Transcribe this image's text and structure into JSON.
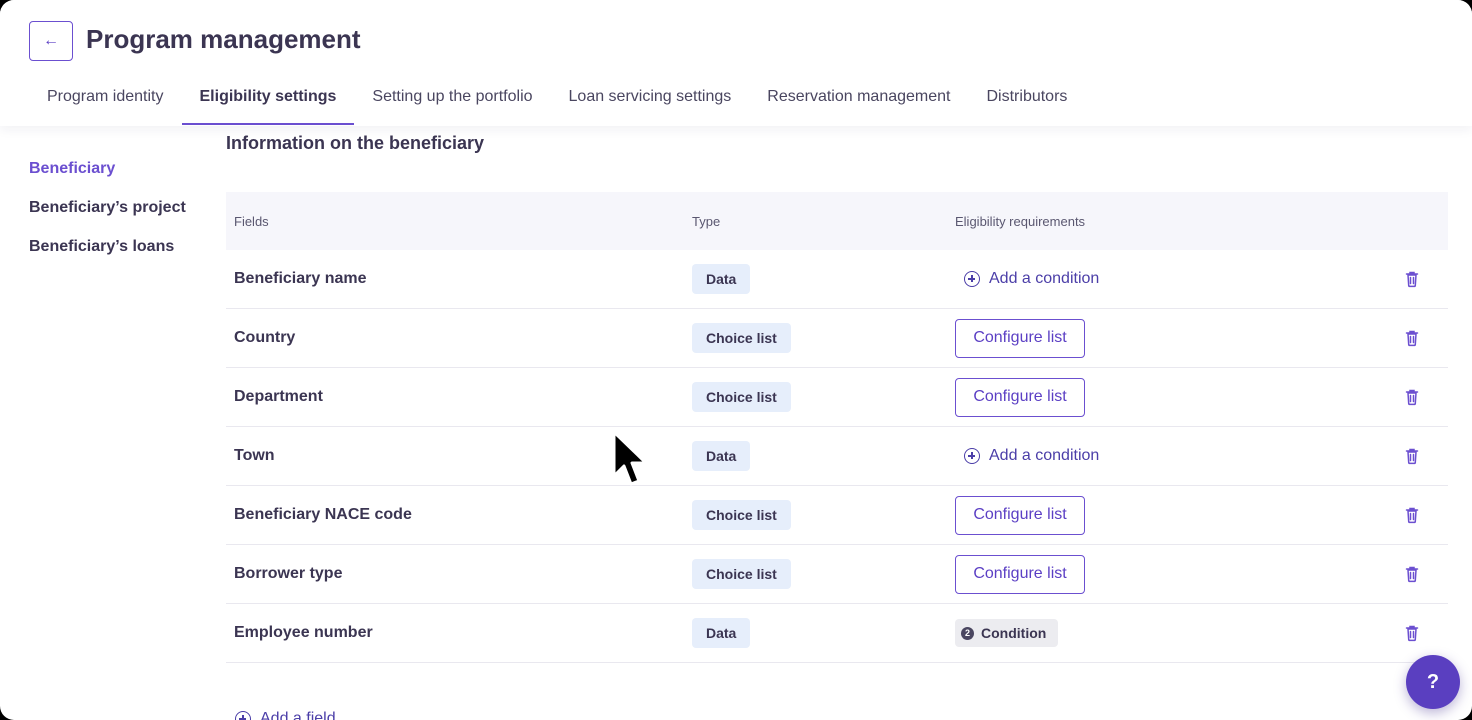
{
  "header": {
    "back_icon": "arrow-left-icon",
    "back_glyph": "←",
    "title": "Program management"
  },
  "tabs": [
    {
      "label": "Program identity"
    },
    {
      "label": "Eligibility settings",
      "active": true
    },
    {
      "label": "Setting up the portfolio"
    },
    {
      "label": "Loan servicing settings"
    },
    {
      "label": "Reservation management"
    },
    {
      "label": "Distributors"
    }
  ],
  "sidenav": [
    {
      "label": "Beneficiary",
      "active": true
    },
    {
      "label": "Beneficiary’s project"
    },
    {
      "label": "Beneficiary’s loans"
    }
  ],
  "section": {
    "title": "Information on the beneficiary"
  },
  "table": {
    "columns": [
      "Fields",
      "Type",
      "Eligibility requirements"
    ],
    "rows": [
      {
        "field": "Beneficiary name",
        "type": "Data",
        "requirement": "Add a condition"
      },
      {
        "field": "Country",
        "type": "Choice list",
        "requirement": "Configure list"
      },
      {
        "field": "Department",
        "type": "Choice list",
        "requirement": "Configure list"
      },
      {
        "field": "Town",
        "type": "Data",
        "requirement": "Add a condition"
      },
      {
        "field": "Beneficiary NACE code",
        "type": "Choice list",
        "requirement": "Configure list"
      },
      {
        "field": "Borrower type",
        "type": "Choice list",
        "requirement": "Configure list"
      },
      {
        "field": "Employee number",
        "type": "Data",
        "requirement": "Condition",
        "condition_count": "2"
      }
    ]
  },
  "add_field_label": "Add a field",
  "help": {
    "glyph": "?",
    "icon": "help-icon"
  },
  "colors": {
    "accent": "#6b4fd0",
    "badge_bg": "#e6eefb",
    "help_bg": "#5a3fc0"
  }
}
